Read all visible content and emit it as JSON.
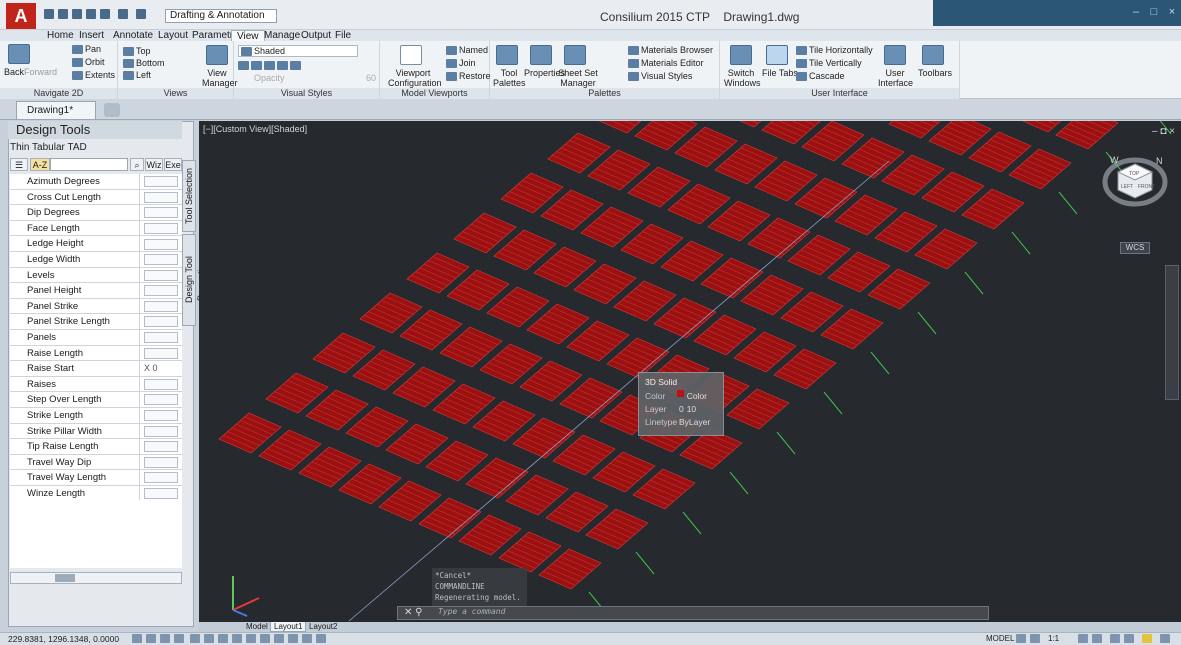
{
  "titlebar": {
    "workspace": "Drafting & Annotation",
    "app_title": "Consilium 2015 CTP",
    "drawing_name": "Drawing1.dwg"
  },
  "ribbon_tabs": [
    "Home",
    "Insert",
    "Annotate",
    "Layout",
    "Parametric",
    "View",
    "Manage",
    "Output",
    "File"
  ],
  "ribbon": {
    "navigate": {
      "title": "Navigate 2D",
      "back": "Back",
      "forward": "Forward",
      "pan": "Pan",
      "orbit": "Orbit",
      "extents": "Extents"
    },
    "views": {
      "title": "Views",
      "items": [
        "Top",
        "Bottom",
        "Left"
      ],
      "manager": "View Manager"
    },
    "visual_styles": {
      "title": "Visual Styles",
      "current": "Shaded",
      "opacity": "Opacity",
      "opacity_value": "60"
    },
    "model_viewports": {
      "title": "Model Viewports",
      "config": "Viewport Configuration",
      "named": "Named",
      "join": "Join",
      "restore": "Restore"
    },
    "palettes": {
      "title": "Palettes",
      "tool_palettes": "Tool Palettes",
      "properties": "Properties",
      "sheet_set": "Sheet Set Manager",
      "materials_browser": "Materials Browser",
      "materials_editor": "Materials Editor",
      "visual_styles": "Visual Styles"
    },
    "user_interface": {
      "title": "User Interface",
      "switch_windows": "Switch Windows",
      "file_tabs": "File Tabs",
      "tile_h": "Tile Horizontally",
      "tile_v": "Tile Vertically",
      "cascade": "Cascade",
      "user_interface": "User Interface",
      "toolbars": "Toolbars"
    }
  },
  "doc_tab": "Drawing1*",
  "palette": {
    "title": "Design Tools",
    "subtitle": "Thin Tabular TAD",
    "sort_label": "A-Z",
    "wiz": "Wiz",
    "exe": "Exe",
    "side_tab_1": "Tool Selection",
    "side_tab_2": "Design Tool Properties",
    "properties": [
      {
        "name": "Azimuth Degrees",
        "value": ""
      },
      {
        "name": "Cross Cut Length",
        "value": ""
      },
      {
        "name": "Dip Degrees",
        "value": ""
      },
      {
        "name": "Face Length",
        "value": ""
      },
      {
        "name": "Ledge Height",
        "value": ""
      },
      {
        "name": "Ledge Width",
        "value": ""
      },
      {
        "name": "Levels",
        "value": ""
      },
      {
        "name": "Panel Height",
        "value": ""
      },
      {
        "name": "Panel Strike",
        "value": ""
      },
      {
        "name": "Panel Strike Length",
        "value": ""
      },
      {
        "name": "Panels",
        "value": ""
      },
      {
        "name": "Raise Length",
        "value": ""
      },
      {
        "name": "Raise Start",
        "value": "X 0"
      },
      {
        "name": "Raises",
        "value": ""
      },
      {
        "name": "Step Over Length",
        "value": ""
      },
      {
        "name": "Strike Length",
        "value": ""
      },
      {
        "name": "Strike Pillar Width",
        "value": ""
      },
      {
        "name": "Tip Raise Length",
        "value": ""
      },
      {
        "name": "Travel Way Dip",
        "value": ""
      },
      {
        "name": "Travel Way Length",
        "value": ""
      },
      {
        "name": "Winze Length",
        "value": ""
      }
    ]
  },
  "viewport": {
    "label": "[−][Custom View][Shaded]",
    "wcs": "WCS",
    "cube_faces": {
      "top": "TOP",
      "left": "LEFT",
      "right": "FRONT"
    },
    "compass": {
      "w": "W",
      "n": "N"
    }
  },
  "tooltip": {
    "title": "3D Solid",
    "color_label": "Color",
    "color_value": "Color 10",
    "color_hex": "#c0101a",
    "layer_label": "Layer",
    "layer_value": "0",
    "linetype_label": "Linetype",
    "linetype_value": "ByLayer"
  },
  "command": {
    "history": [
      "*Cancel*",
      "COMMANDLINE",
      "Regenerating model."
    ],
    "placeholder": "Type a command"
  },
  "layout_tabs": [
    "Model",
    "Layout1",
    "Layout2"
  ],
  "status": {
    "coords": "229.8381, 1296.1348, 0.0000",
    "model": "MODEL",
    "scale": "1:1"
  },
  "colors": {
    "panel_fill": "#9b1111",
    "panel_line": "#d23a3a",
    "viewport_bg": "#26292e"
  }
}
